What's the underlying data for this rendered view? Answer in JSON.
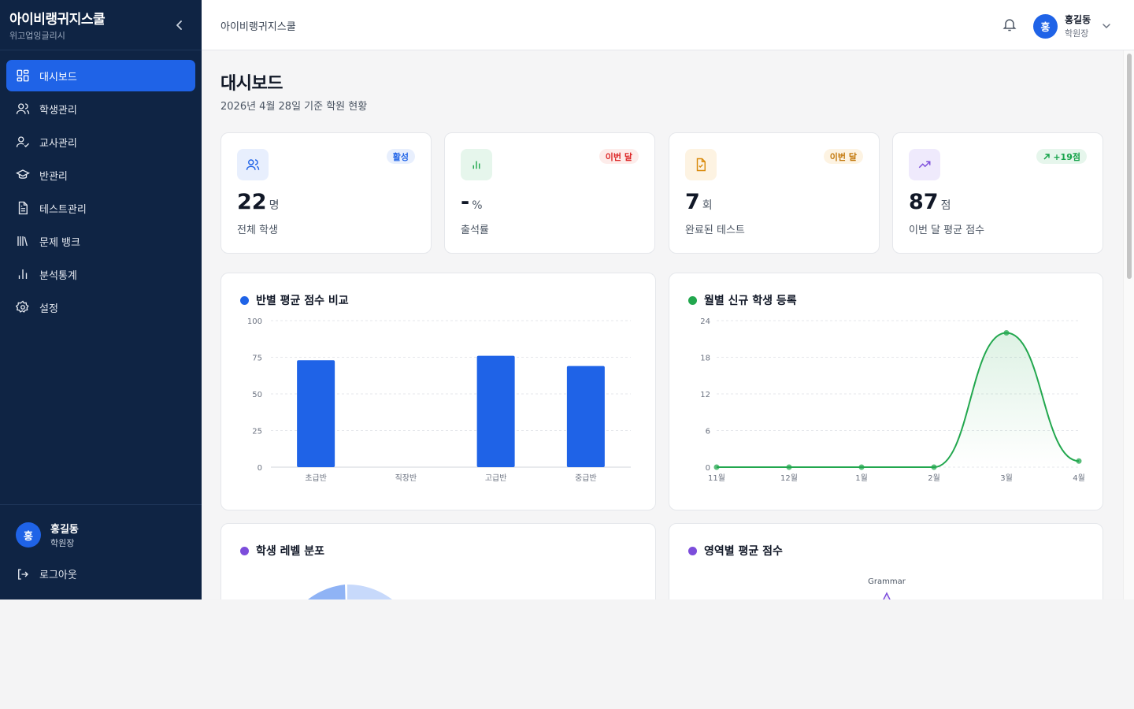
{
  "sidebar": {
    "brand_title": "아이비랭귀지스쿨",
    "brand_sub": "위고업잉글리시",
    "items": [
      {
        "label": "대시보드",
        "icon": "dashboard-grid-icon"
      },
      {
        "label": "학생관리",
        "icon": "users-icon"
      },
      {
        "label": "교사관리",
        "icon": "user-check-icon"
      },
      {
        "label": "반관리",
        "icon": "graduation-cap-icon"
      },
      {
        "label": "테스트관리",
        "icon": "document-icon"
      },
      {
        "label": "문제 뱅크",
        "icon": "library-icon"
      },
      {
        "label": "분석통계",
        "icon": "bar-chart-icon"
      },
      {
        "label": "설정",
        "icon": "gear-icon"
      }
    ],
    "user_name": "홍길동",
    "user_role": "학원장",
    "avatar_initial": "홍",
    "logout_label": "로그아웃"
  },
  "topbar": {
    "title": "아이비랭귀지스쿨",
    "user_name": "홍길동",
    "user_role": "학원장",
    "avatar_initial": "홍"
  },
  "page": {
    "title": "대시보드",
    "subtitle": "2026년 4월 28일 기준 학원 현황"
  },
  "stats": [
    {
      "value": "22",
      "unit": "명",
      "label": "전체 학생",
      "badge": "활성",
      "icon": "users-icon"
    },
    {
      "value": "-",
      "unit": "%",
      "label": "출석률",
      "badge": "이번 달",
      "icon": "bar-chart-icon"
    },
    {
      "value": "7",
      "unit": "회",
      "label": "완료된 테스트",
      "badge": "이번 달",
      "icon": "file-check-icon"
    },
    {
      "value": "87",
      "unit": "점",
      "label": "이번 달 평균 점수",
      "badge": "+19점",
      "icon": "trending-up-icon"
    }
  ],
  "colors": {
    "primary": "#1f63e7",
    "sidebar": "#0f2444",
    "green": "#22a74e",
    "purple": "#7c4ddb"
  },
  "cards": {
    "bar_title": "반별 평균 점수 비교",
    "line_title": "월별 신규 학생 등록",
    "pie_title": "학생 레벨 분포",
    "radar_title": "영역별 평균 점수",
    "radar_axis_top": "Grammar"
  },
  "chart_data": [
    {
      "type": "bar",
      "title": "반별 평균 점수 비교",
      "categories": [
        "초급반",
        "직장반",
        "고급반",
        "중급반"
      ],
      "values": [
        73,
        0,
        76,
        69
      ],
      "yticks": [
        "0",
        "25",
        "50",
        "75",
        "100"
      ],
      "ylim": [
        0,
        100
      ],
      "grid": true
    },
    {
      "type": "line",
      "title": "월별 신규 학생 등록",
      "categories": [
        "11월",
        "12월",
        "1월",
        "2월",
        "3월",
        "4월"
      ],
      "values": [
        0,
        0,
        0,
        0,
        22,
        1
      ],
      "yticks": [
        "0",
        "6",
        "12",
        "18",
        "24"
      ],
      "ylim": [
        0,
        24
      ],
      "grid": true
    }
  ]
}
